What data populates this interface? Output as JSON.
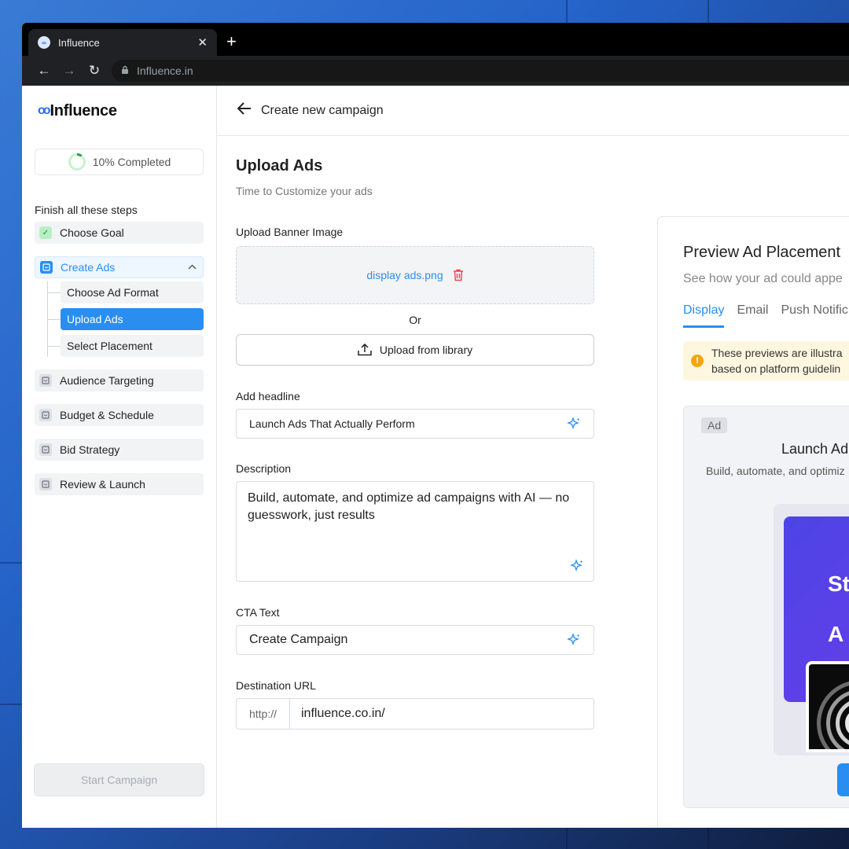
{
  "browser": {
    "tab_title": "Influence",
    "tab_close": "✕",
    "new_tab": "+",
    "url": "Influence.in",
    "back": "←",
    "forward": "→",
    "reload": "↻"
  },
  "brand": {
    "name": "Influence"
  },
  "progress": {
    "label": "10% Completed",
    "fraction": 0.1
  },
  "sidebar": {
    "steps_title": "Finish all these steps",
    "steps": [
      {
        "label": "Choose Goal",
        "status": "done"
      },
      {
        "label": "Create Ads",
        "status": "active",
        "expanded": true
      },
      {
        "label": "Audience Targeting",
        "status": "pending"
      },
      {
        "label": "Budget & Schedule",
        "status": "pending"
      },
      {
        "label": "Bid Strategy",
        "status": "pending"
      },
      {
        "label": "Review & Launch",
        "status": "pending"
      }
    ],
    "substeps": [
      {
        "label": "Choose Ad Format",
        "active": false
      },
      {
        "label": "Upload Ads",
        "active": true
      },
      {
        "label": "Select Placement",
        "active": false
      }
    ],
    "start_button": "Start Campaign"
  },
  "header": {
    "title": "Create new campaign"
  },
  "form": {
    "title": "Upload Ads",
    "subtitle": "Time to Customize your ads",
    "banner_label": "Upload Banner Image",
    "banner_file": "display ads.png",
    "or": "Or",
    "library_button": "Upload from library",
    "headline_label": "Add headline",
    "headline_value": "Launch Ads That Actually Perform",
    "description_label": "Description",
    "description_value": "Build, automate, and optimize ad campaigns with AI — no guesswork, just results",
    "cta_label": "CTA Text",
    "cta_value": "Create Campaign",
    "url_label": "Destination URL",
    "url_prefix": "http://",
    "url_value": "influence.co.in/"
  },
  "preview": {
    "title": "Preview Ad Placement",
    "subtitle": "See how your ad could appe",
    "tabs": [
      "Display",
      "Email",
      "Push Notific"
    ],
    "active_tab": "Display",
    "warning_line1": "These previews are illustra",
    "warning_line2": "based on platform guidelin",
    "ad_tag": "Ad",
    "ad_title": "Launch Ad",
    "ad_subtitle": "Build, automate, and optimiz",
    "banner_line1": "St",
    "banner_line2": "A"
  },
  "colors": {
    "accent": "#2a8ef0",
    "done_green": "#13882d",
    "warning": "#f2a60f",
    "banner_purple": "#4d44e6",
    "delete_red": "#e5484d"
  },
  "icons": {
    "favicon": "infinity-logo-icon",
    "trash": "trash-icon",
    "upload": "upload-icon",
    "sparkle": "sparkle-icon",
    "check": "check-icon",
    "step": "step-icon",
    "chevron_up": "chevron-up-icon",
    "arrow_back": "arrow-left-icon",
    "warning": "warning-icon",
    "lock": "lock-icon"
  }
}
